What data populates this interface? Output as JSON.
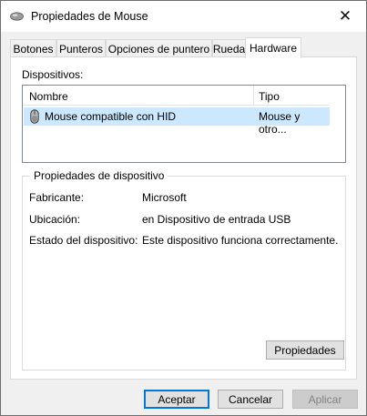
{
  "window": {
    "title": "Propiedades de Mouse",
    "close_glyph": "✕"
  },
  "tabs": [
    {
      "label": "Botones"
    },
    {
      "label": "Punteros"
    },
    {
      "label": "Opciones de puntero"
    },
    {
      "label": "Rueda"
    },
    {
      "label": "Hardware",
      "active": true
    }
  ],
  "devices": {
    "label": "Dispositivos:",
    "columns": {
      "name": "Nombre",
      "type": "Tipo"
    },
    "rows": [
      {
        "name": "Mouse compatible con HID",
        "type": "Mouse y otro...",
        "icon": "mouse-icon",
        "selected": true
      }
    ]
  },
  "device_properties": {
    "title": "Propiedades de dispositivo",
    "rows": [
      {
        "label": "Fabricante:",
        "value": "Microsoft"
      },
      {
        "label": "Ubicación:",
        "value": "en Dispositivo de entrada USB"
      },
      {
        "label": "Estado del dispositivo:",
        "value": "Este dispositivo funciona correctamente."
      }
    ],
    "button": "Propiedades"
  },
  "footer": {
    "accept": "Aceptar",
    "cancel": "Cancelar",
    "apply": "Aplicar"
  },
  "colors": {
    "selection": "#cce8ff",
    "focus_border": "#0078d7"
  }
}
